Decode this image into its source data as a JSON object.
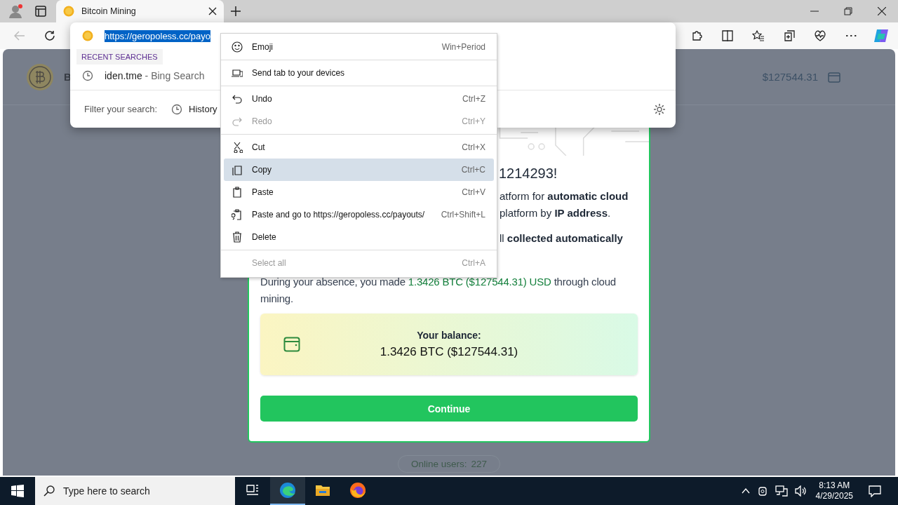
{
  "browser": {
    "tabs": [
      {
        "title": "Bitcoin Mining",
        "selected": true
      }
    ]
  },
  "omnibox": {
    "value": "https://geropoless.cc/payo",
    "value_selected": true,
    "section_label": "RECENT SEARCHES",
    "suggestions": [
      {
        "query": "iden.tme",
        "source": "- Bing Search"
      }
    ],
    "filter_label": "Filter your search:",
    "filters": [
      {
        "label": "History"
      }
    ]
  },
  "context_menu": [
    {
      "kind": "item",
      "label": "Emoji",
      "shortcut": "Win+Period",
      "disabled": false,
      "selected": false
    },
    {
      "kind": "separator"
    },
    {
      "kind": "item",
      "label": "Send tab to your devices",
      "disabled": false,
      "selected": false
    },
    {
      "kind": "separator"
    },
    {
      "kind": "item",
      "label": "Undo",
      "shortcut": "Ctrl+Z",
      "disabled": false,
      "selected": false
    },
    {
      "kind": "item",
      "label": "Redo",
      "shortcut": "Ctrl+Y",
      "disabled": true,
      "selected": false
    },
    {
      "kind": "separator"
    },
    {
      "kind": "item",
      "label": "Cut",
      "shortcut": "Ctrl+X",
      "disabled": false,
      "selected": false
    },
    {
      "kind": "item",
      "label": "Copy",
      "shortcut": "Ctrl+C",
      "disabled": false,
      "selected": true
    },
    {
      "kind": "item",
      "label": "Paste",
      "shortcut": "Ctrl+V",
      "disabled": false,
      "selected": false
    },
    {
      "kind": "item",
      "label": "Paste and go to https://geropoless.cc/payouts/",
      "shortcut": "Ctrl+Shift+L",
      "disabled": false,
      "selected": false
    },
    {
      "kind": "item",
      "label": "Delete",
      "disabled": false,
      "selected": false
    },
    {
      "kind": "separator"
    },
    {
      "kind": "item",
      "label": "Select all",
      "shortcut": "Ctrl+A",
      "disabled": true,
      "selected": false
    }
  ],
  "page": {
    "header": {
      "brand": "B",
      "balance": "$127544.31"
    },
    "card": {
      "heading": "1214293!",
      "fragments": [
        "atform for **automatic cloud**",
        "platform by **IP address**.",
        "ll **collected automatically**"
      ],
      "absence": [
        "During your absence, you made ",
        "1.3426 BTC ($127544.31) USD",
        " through cloud mining."
      ],
      "balance_label": "Your balance:",
      "balance_value": "1.3426 BTC ($127544.31)",
      "button": "Continue"
    },
    "online_label": "Online users:",
    "online_count": "227"
  },
  "taskbar": {
    "search_placeholder": "Type here to search",
    "apps": [
      {
        "selected": false
      },
      {
        "selected": true
      },
      {
        "selected": false
      },
      {
        "selected": false
      }
    ],
    "time": "8:13 AM",
    "date": "4/29/2025"
  }
}
